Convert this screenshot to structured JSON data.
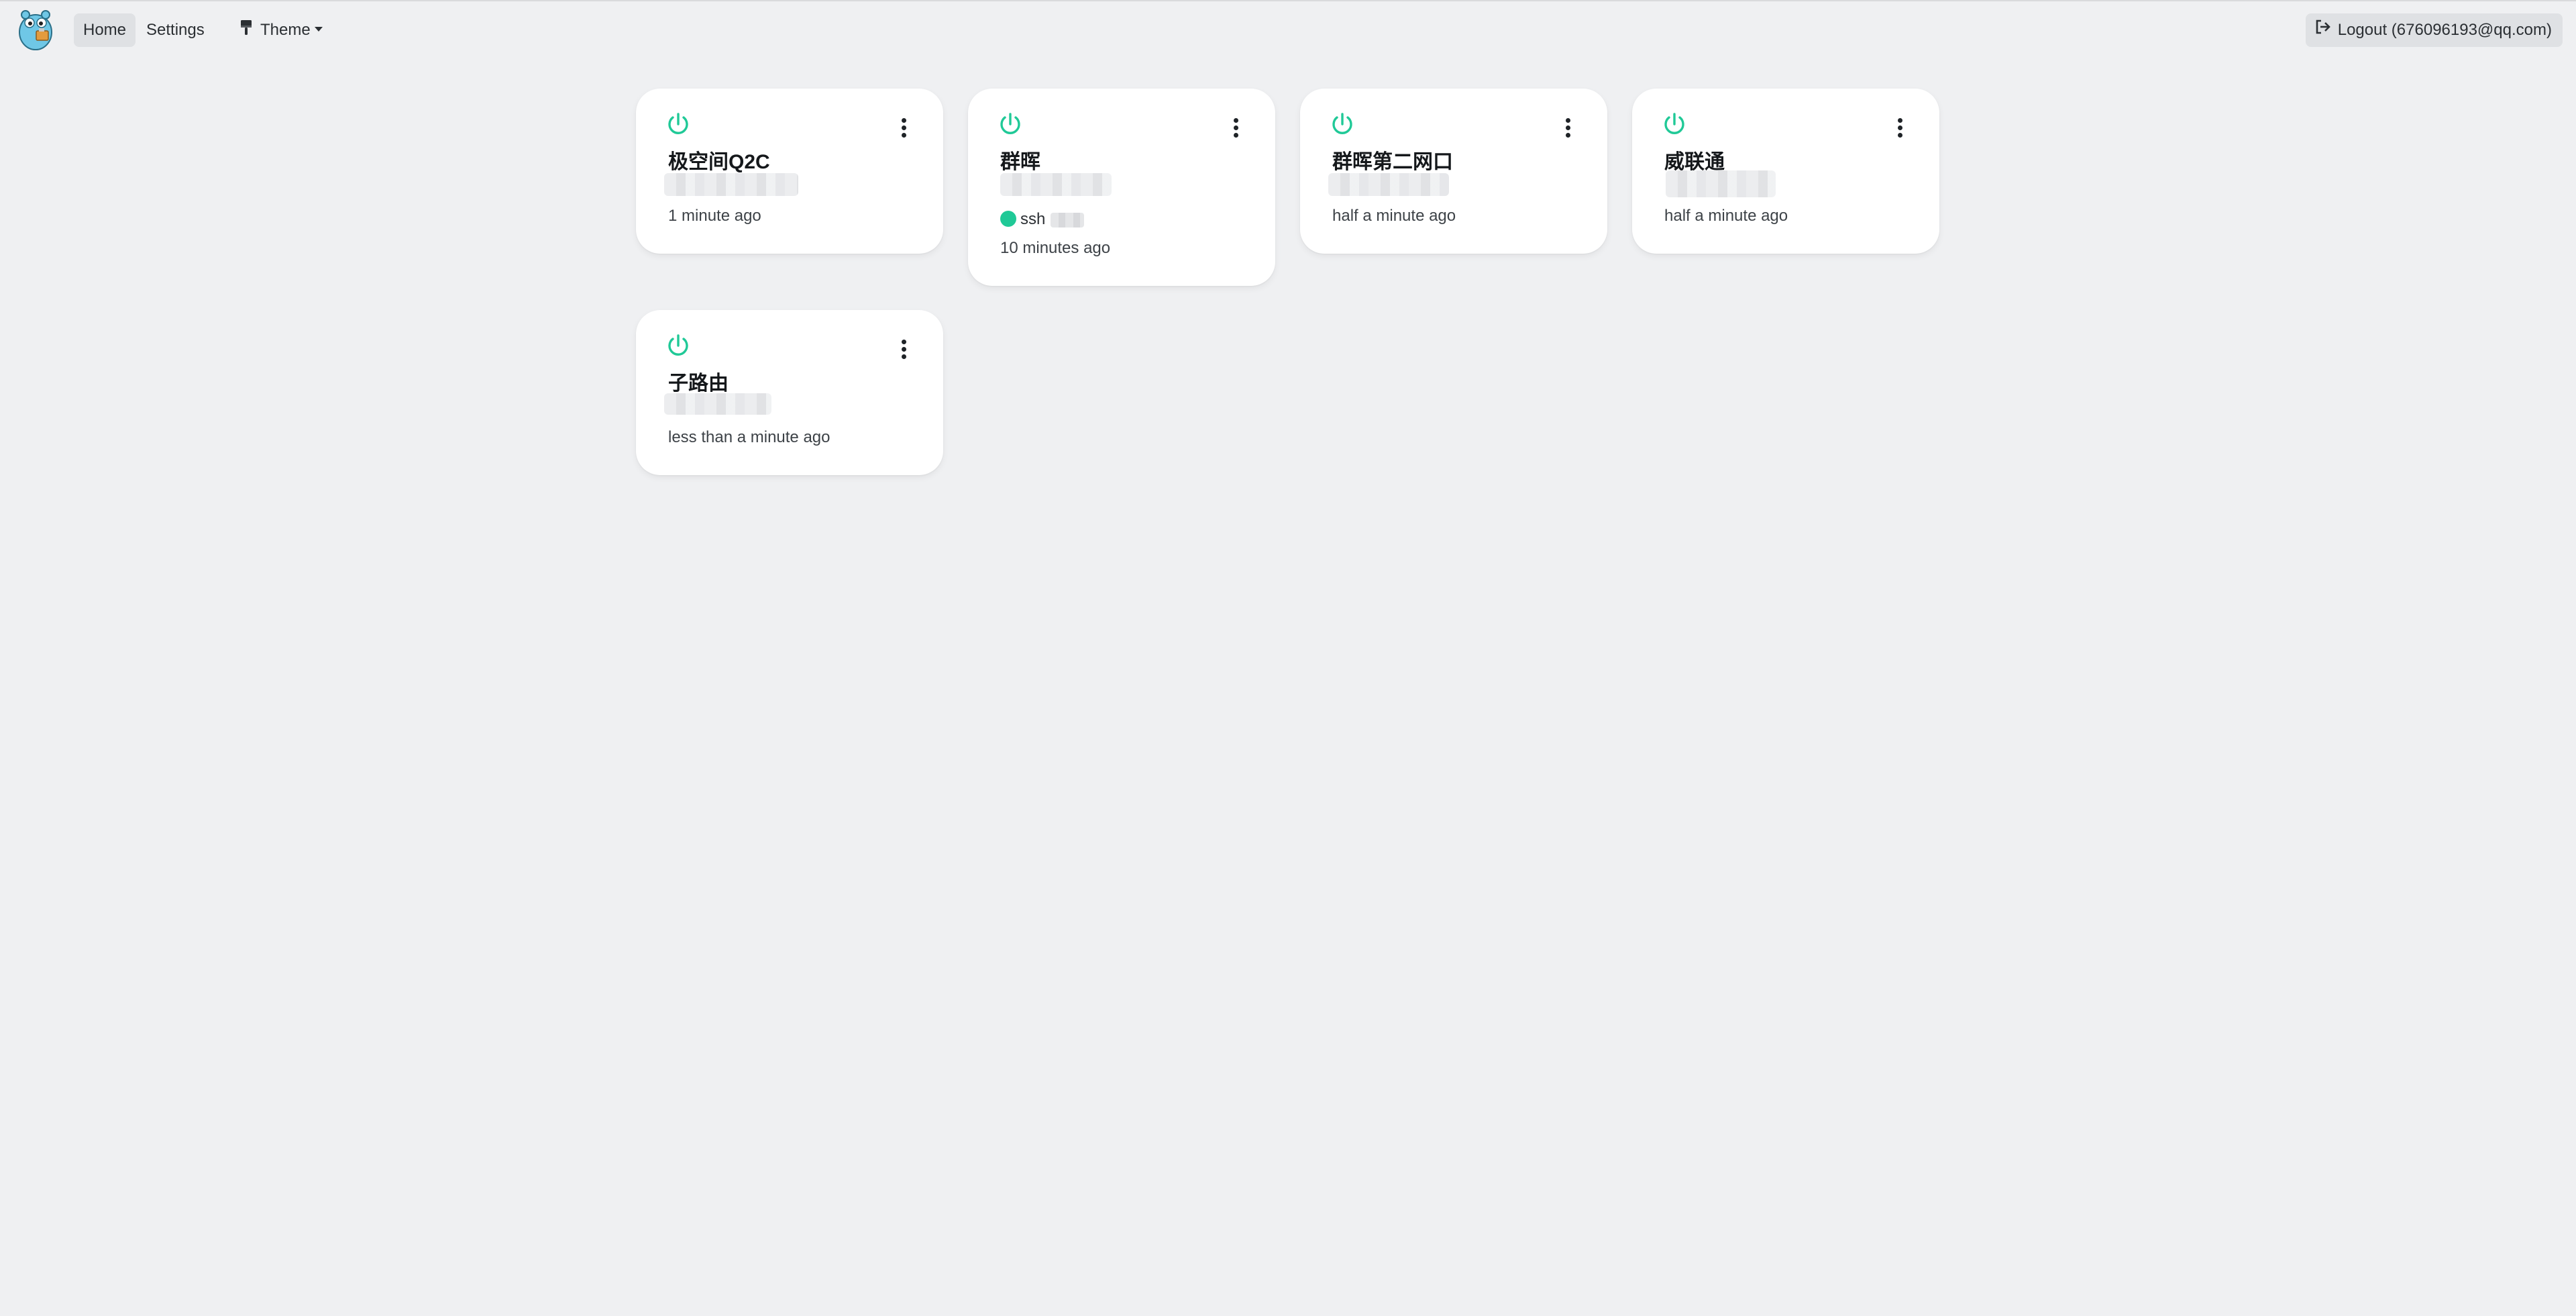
{
  "nav": {
    "home": "Home",
    "settings": "Settings",
    "theme": "Theme",
    "logout": "Logout (676096193@qq.com)"
  },
  "colors": {
    "accent": "#20c997",
    "background": "#eff0f2",
    "card": "#ffffff"
  },
  "devices": [
    {
      "name": "极空间Q2C",
      "time": "1 minute ago",
      "status_icon": "power-icon"
    },
    {
      "name": "群晖",
      "tag": "ssh",
      "time": "10 minutes ago",
      "status_icon": "power-icon"
    },
    {
      "name": "群晖第二网口",
      "time": "half a minute ago",
      "status_icon": "power-icon"
    },
    {
      "name": "威联通",
      "time": "half a minute ago",
      "status_icon": "power-icon"
    },
    {
      "name": "子路由",
      "time": "less than a minute ago",
      "status_icon": "power-icon"
    }
  ]
}
